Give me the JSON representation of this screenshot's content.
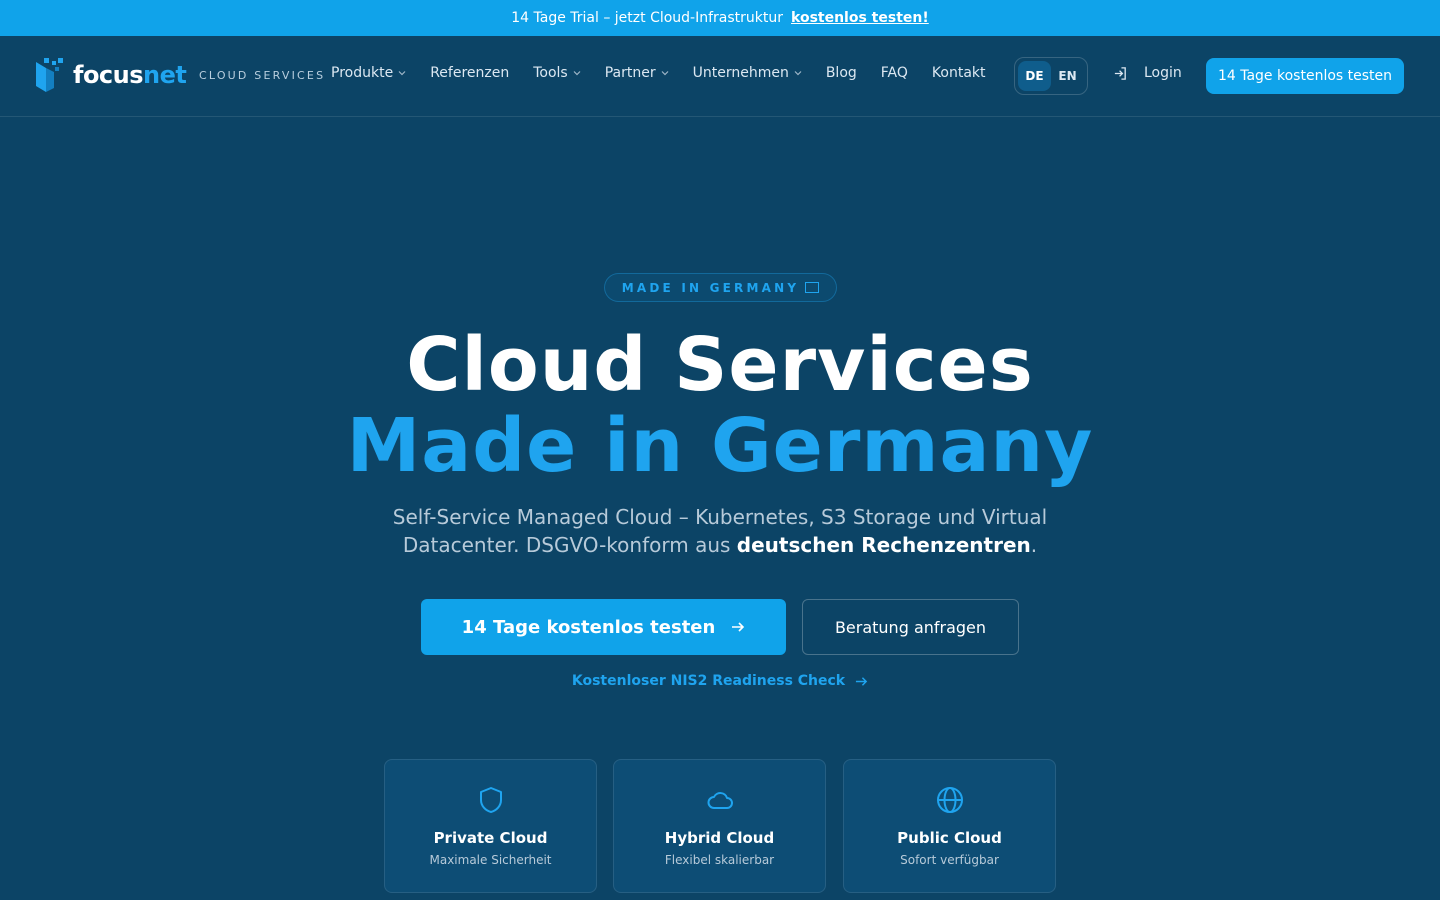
{
  "announcement": {
    "text": "14 Tage Trial – jetzt Cloud-Infrastruktur",
    "link": "kostenlos testen!"
  },
  "brand": {
    "word_part1": "focus",
    "word_part2": "net",
    "tagline": "CLOUD SERVICES",
    "icon": "focusnet-logo-icon"
  },
  "nav": {
    "items": [
      {
        "label": "Produkte",
        "has_dropdown": true
      },
      {
        "label": "Referenzen",
        "has_dropdown": false
      },
      {
        "label": "Tools",
        "has_dropdown": true
      },
      {
        "label": "Partner",
        "has_dropdown": true
      },
      {
        "label": "Unternehmen",
        "has_dropdown": true
      },
      {
        "label": "Blog",
        "has_dropdown": false
      },
      {
        "label": "FAQ",
        "has_dropdown": false
      },
      {
        "label": "Kontakt",
        "has_dropdown": false
      }
    ],
    "lang": {
      "active": "DE",
      "other": "EN"
    },
    "login": "Login",
    "cta": "14 Tage kostenlos testen"
  },
  "hero": {
    "badge": "MADE IN GERMANY",
    "title_line1": "Cloud Services",
    "title_line2": "Made in Germany",
    "subtitle_part1": "Self-Service Managed Cloud – Kubernetes, S3 Storage und Virtual Datacenter. DSGVO-konform aus",
    "subtitle_bold": "deutschen Rechenzentren",
    "subtitle_end": ".",
    "primary_cta": "14 Tage kostenlos testen",
    "secondary_cta": "Beratung anfragen",
    "nis2_link": "Kostenloser NIS2 Readiness Check"
  },
  "cards": [
    {
      "title": "Private Cloud",
      "subtitle": "Maximale Sicherheit",
      "icon": "shield-icon"
    },
    {
      "title": "Hybrid Cloud",
      "subtitle": "Flexibel skalierbar",
      "icon": "cloud-icon"
    },
    {
      "title": "Public Cloud",
      "subtitle": "Sofort verfügbar",
      "icon": "globe-icon"
    }
  ],
  "colors": {
    "background": "#0c4466",
    "accent": "#10a3ea",
    "accent_text": "#1fa4ef"
  }
}
